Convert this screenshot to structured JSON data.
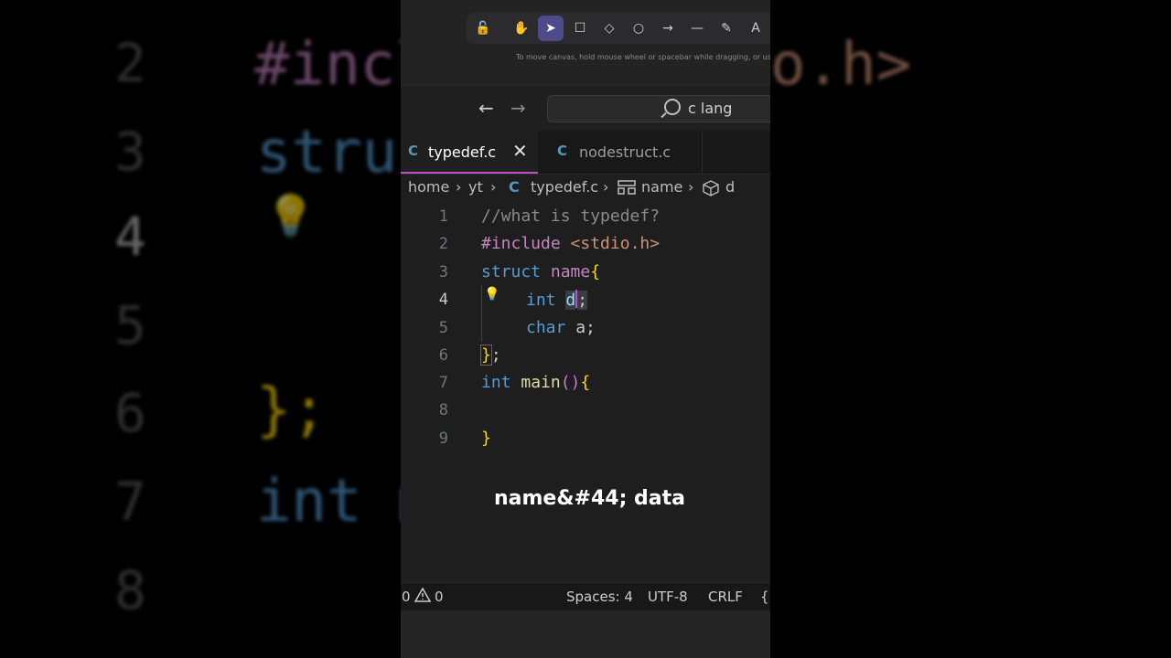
{
  "background": {
    "lines": [
      {
        "num": "2",
        "text": "#incl",
        "right": "o.h>"
      },
      {
        "num": "3",
        "text": "stru"
      },
      {
        "num": "4",
        "text": ""
      },
      {
        "num": "5",
        "text": ""
      },
      {
        "num": "6",
        "text": "};"
      },
      {
        "num": "7",
        "text": "int m"
      },
      {
        "num": "8",
        "text": ""
      }
    ]
  },
  "toolbar": {
    "tools": [
      {
        "icon": "lock-icon",
        "glyph": "🔓"
      },
      {
        "icon": "hand-icon",
        "glyph": "✋"
      },
      {
        "icon": "selection-pointer-icon",
        "glyph": "➤"
      },
      {
        "icon": "rectangle-icon",
        "glyph": "☐"
      },
      {
        "icon": "diamond-icon",
        "glyph": "◇"
      },
      {
        "icon": "ellipse-icon",
        "glyph": "○"
      },
      {
        "icon": "arrow-icon",
        "glyph": "→"
      },
      {
        "icon": "line-icon",
        "glyph": "—"
      },
      {
        "icon": "pencil-icon",
        "glyph": "✎"
      },
      {
        "icon": "text-icon",
        "glyph": "A"
      }
    ],
    "hint": "To move canvas, hold mouse wheel or spacebar while dragging, or use"
  },
  "titlebar": {
    "back": "←",
    "forward": "→",
    "search_text": "c lang"
  },
  "tabs": [
    {
      "icon": "C",
      "label": "typedef.c",
      "close": "✕"
    },
    {
      "icon": "C",
      "label": "nodestruct.c"
    }
  ],
  "breadcrumb": {
    "home": "home",
    "sep": "›",
    "yt": "yt",
    "file_icon": "C",
    "file": "typedef.c",
    "struct": "name",
    "member": "d"
  },
  "editor": {
    "line_numbers": [
      "1",
      "2",
      "3",
      "4",
      "5",
      "6",
      "7",
      "8",
      "9"
    ],
    "l1": "//what is typedef?",
    "l2_dir": "#include",
    "l2_hdr": "<stdio.h>",
    "l3_kw": "struct",
    "l3_name": "name",
    "l3_brace": "{",
    "l4_type": "int",
    "l4_var": "d",
    "l4_semi": ";",
    "l5_type": "char",
    "l5_rest": "a;",
    "l6_brace": "}",
    "l6_semi": ";",
    "l7_type": "int",
    "l7_fn": "main",
    "l7_paren": "()",
    "l7_brace": "{",
    "l9_brace": "}"
  },
  "caption": "name&#44; data",
  "statusbar": {
    "errors": "0",
    "warnings": "0",
    "spaces": "Spaces: 4",
    "encoding": "UTF-8",
    "eol": "CRLF",
    "lang": "{"
  },
  "colors": {
    "keyword": "#569cd6",
    "control": "#c586c0",
    "struct_name": "#c586c0",
    "string": "#ce9178",
    "comment": "#6a9955",
    "function": "#dcdcaa",
    "bracket": "#ffd700",
    "accent": "#c04fc5"
  }
}
